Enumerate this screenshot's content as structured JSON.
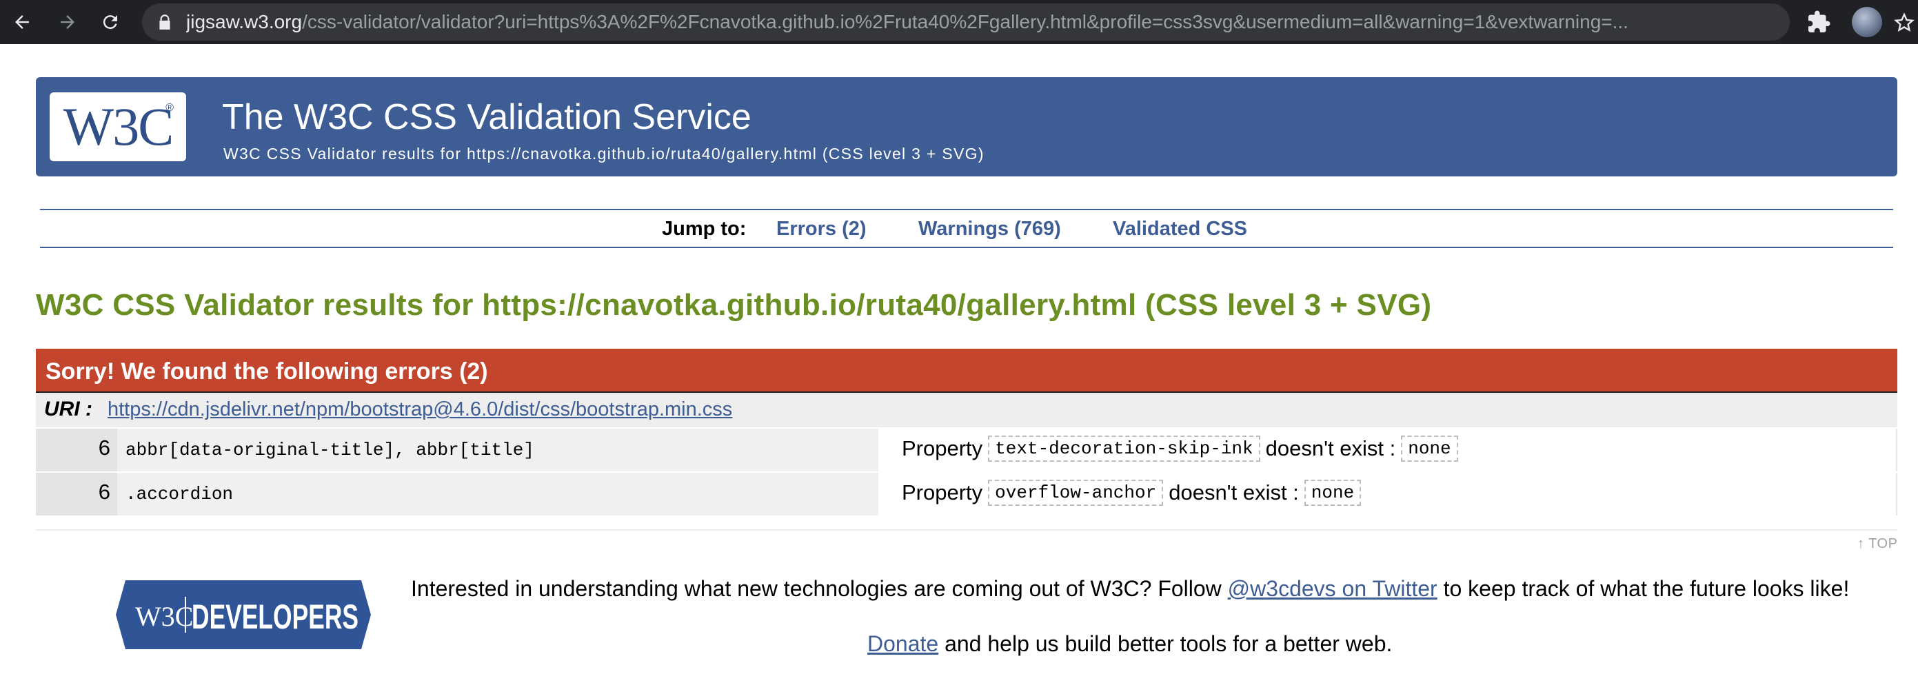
{
  "browser": {
    "url_host": "jigsaw.w3.org",
    "url_path": "/css-validator/validator?uri=https%3A%2F%2Fcnavotka.github.io%2Fruta40%2Fgallery.html&profile=css3svg&usermedium=all&warning=1&vextwarning=..."
  },
  "banner": {
    "logo_text": "W3C",
    "logo_reg": "®",
    "title": "The W3C CSS Validation Service",
    "subtitle": "W3C CSS Validator results for https://cnavotka.github.io/ruta40/gallery.html (CSS level 3 + SVG)"
  },
  "jump_nav": {
    "label": "Jump to:",
    "errors": "Errors (2)",
    "warnings": "Warnings (769)",
    "validated": "Validated CSS"
  },
  "results_heading": "W3C CSS Validator results for https://cnavotka.github.io/ruta40/gallery.html (CSS level 3 + SVG)",
  "errors": {
    "header": "Sorry! We found the following errors (2)",
    "uri_label": "URI :",
    "uri": "https://cdn.jsdelivr.net/npm/bootstrap@4.6.0/dist/css/bootstrap.min.css",
    "rows": [
      {
        "line": "6",
        "context": "abbr[data-original-title], abbr[title]",
        "prefix": "Property",
        "property": "text-decoration-skip-ink",
        "middle": "doesn't exist :",
        "value": "none"
      },
      {
        "line": "6",
        "context": ".accordion",
        "prefix": "Property",
        "property": "overflow-anchor",
        "middle": "doesn't exist :",
        "value": "none"
      }
    ]
  },
  "top_link": "↑ TOP",
  "footer": {
    "logo_w3c": "W3C",
    "logo_developers": "DEVELOPERS",
    "follow_text_before": "Interested in understanding what new technologies are coming out of W3C? Follow ",
    "follow_link": "@w3cdevs on Twitter",
    "follow_text_after": " to keep track of what the future looks like!",
    "donate_link": "Donate",
    "donate_text": " and help us build better tools for a better web."
  },
  "colors": {
    "brand_blue": "#3d5d94",
    "heading_green": "#6b8e23",
    "error_red": "#c4452e"
  }
}
